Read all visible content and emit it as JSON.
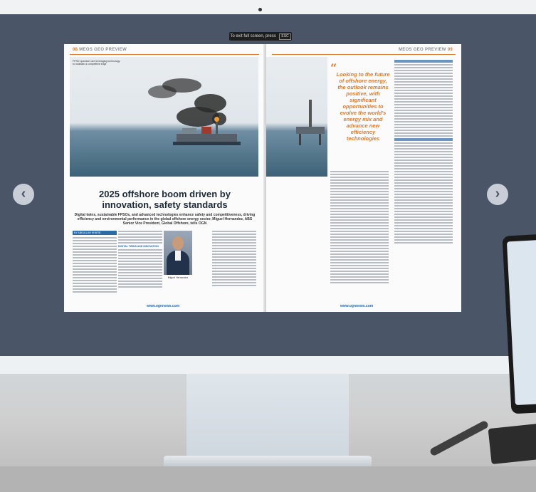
{
  "viewer": {
    "fullscreen_hint": "To exit full screen, press",
    "fullscreen_key": "ESC",
    "prev_label": "‹",
    "next_label": "›"
  },
  "magazine": {
    "left_folio_num": "08",
    "left_folio_title": "MEOS GEO PREVIEW",
    "right_folio_title": "MEOS GEO PREVIEW",
    "right_folio_num": "09",
    "photo_caption": "FPSO operators are leveraging technology to maintain a competitive edge",
    "headline": "2025 offshore boom driven by innovation, safety standards",
    "deck": "Digital twins, sustainable FPSOs, and advanced technologies enhance safety and competitiveness, driving efficiency and environmental performance in the global offshore energy sector, Miguel Hernandez, ABS Senior Vice President, Global Offshore, tells OGN",
    "byline": "BY ABDULLAH KHATIB",
    "subhead_1": "DIGITAL TWINS AND INNOVATION",
    "portrait_caption": "Miguel Hernandez",
    "pull_quote": "Looking to the future of offshore energy, the outlook remains positive, with significant opportunities to evolve the world's energy mix and advance new efficiency technologies",
    "url_left": "www.ognnews.com",
    "url_right": "www.ognnews.com"
  }
}
